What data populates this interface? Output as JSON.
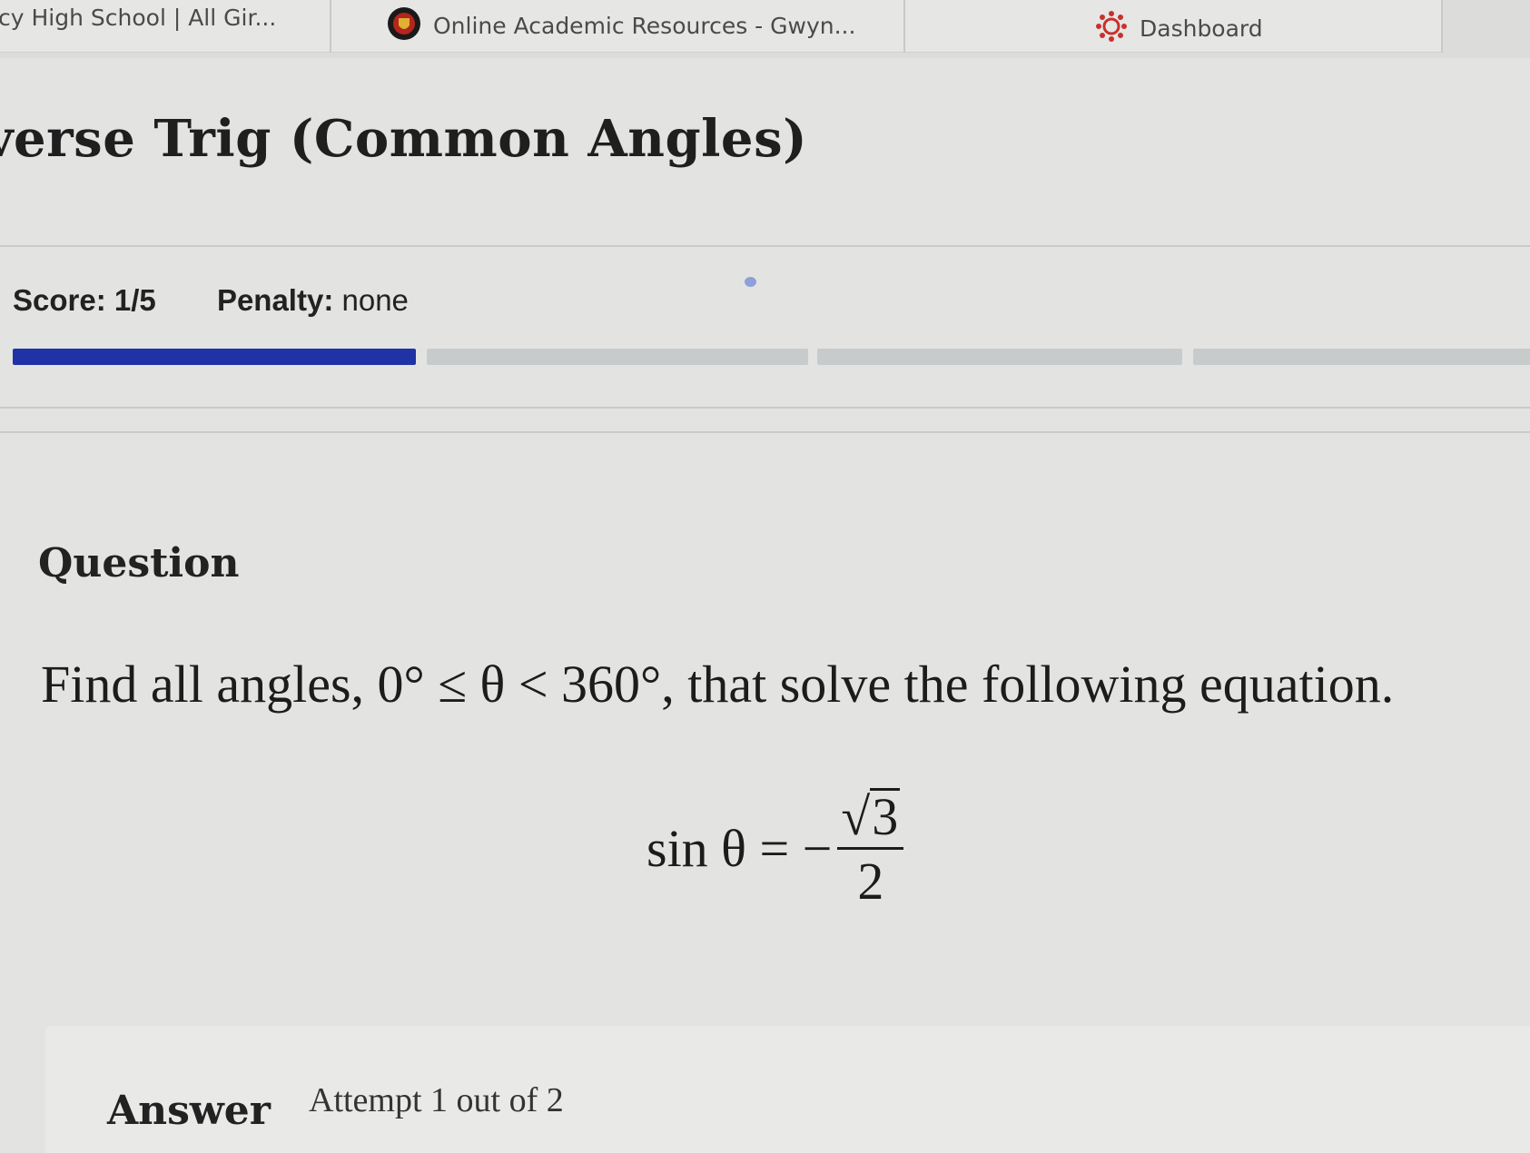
{
  "bookmarks": [
    {
      "label": "cy High School | All Gir...",
      "icon": "school-icon"
    },
    {
      "label": "Online Academic Resources - Gwyn...",
      "icon": "crest-icon"
    },
    {
      "label": "Dashboard",
      "icon": "canvas-icon"
    }
  ],
  "page": {
    "title": "verse Trig (Common Angles)"
  },
  "score": {
    "score_label": "Score:",
    "score_value": "1/5",
    "penalty_label": "Penalty:",
    "penalty_value": "none",
    "progress_completed": 1,
    "progress_total": 5,
    "progress_color": "#1f33a6"
  },
  "question": {
    "heading": "Question",
    "prompt": "Find all angles, 0° ≤ θ < 360°, that solve the following equation.",
    "equation_lhs": "sin θ = −",
    "equation_numerator": "3",
    "equation_denominator": "2"
  },
  "answer": {
    "label": "Answer",
    "attempt_text": "Attempt 1 out of 2"
  }
}
